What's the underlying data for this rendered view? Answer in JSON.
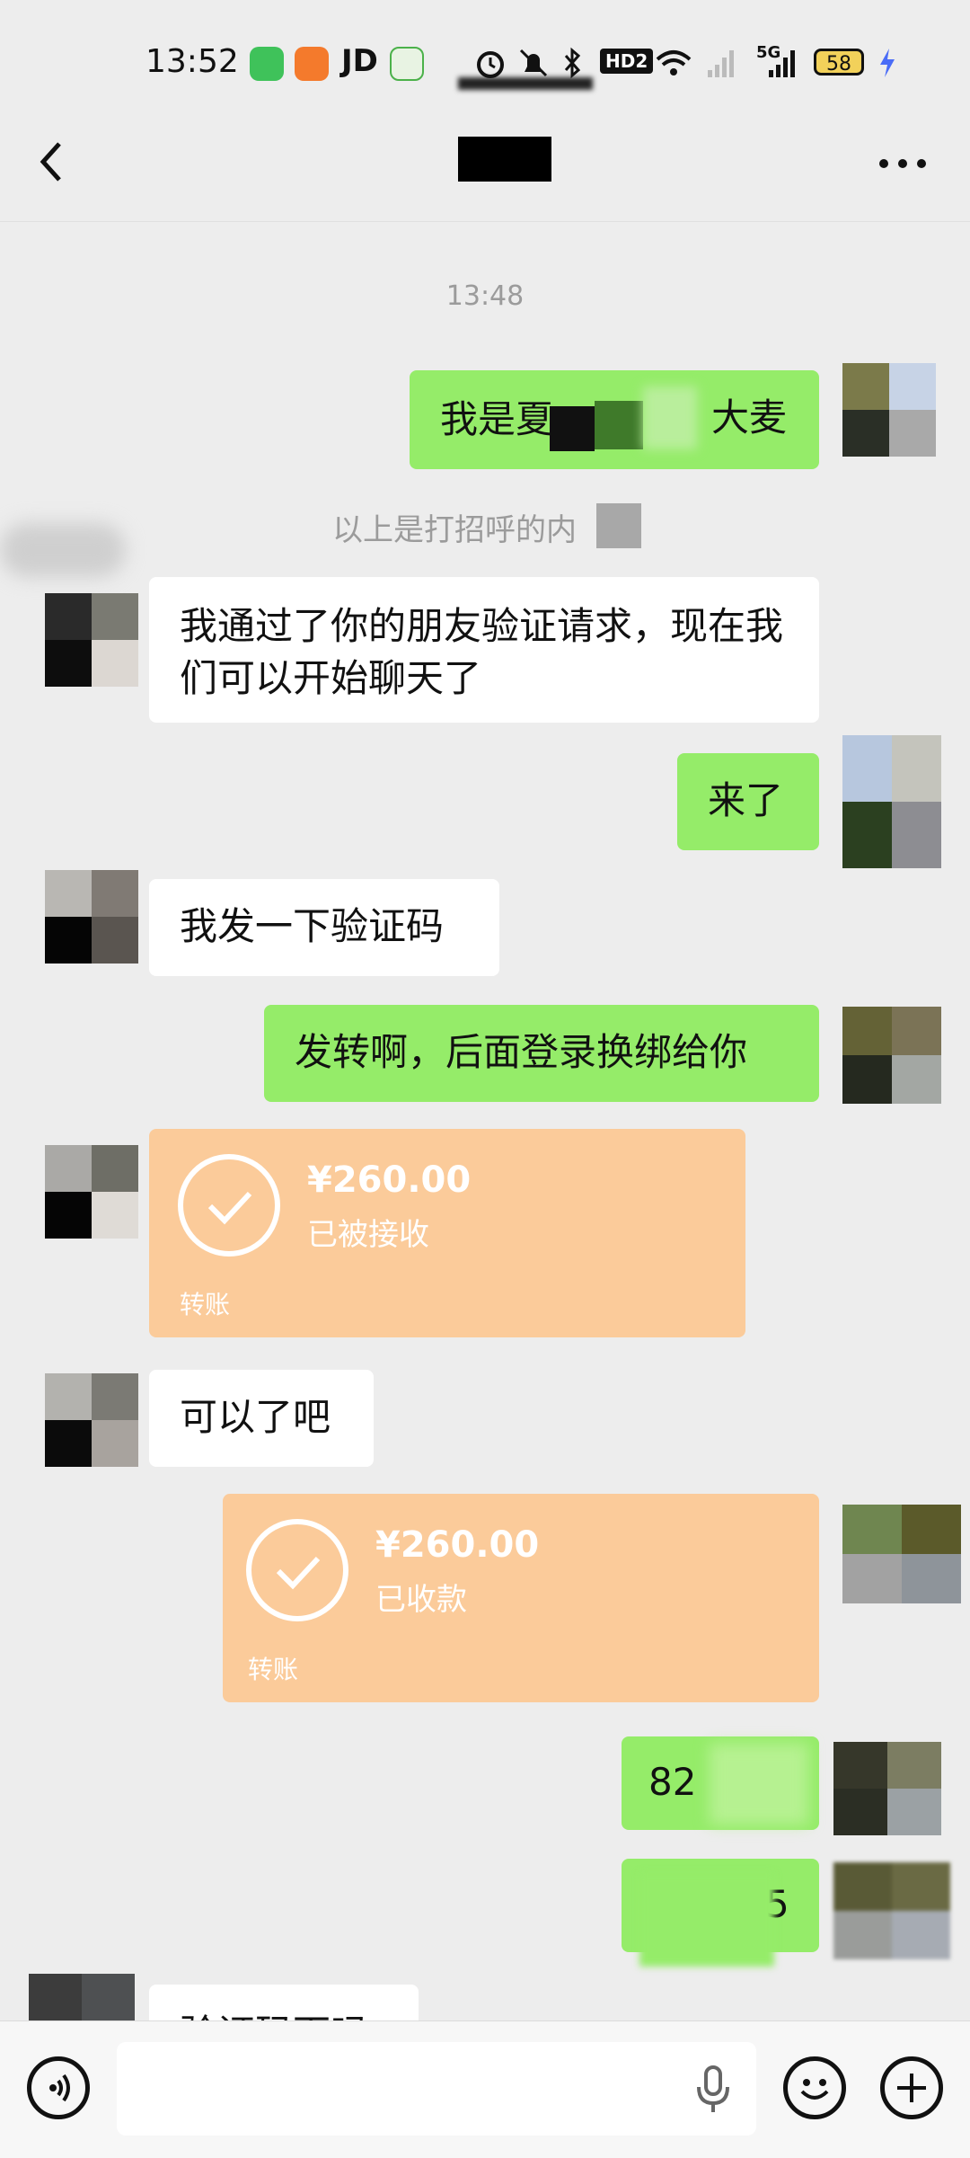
{
  "status_bar": {
    "time": "13:52",
    "jd_label": "JD",
    "hd_label": "HD2",
    "network_label": "5G",
    "battery": "58"
  },
  "header": {
    "more_label": "···"
  },
  "chat": {
    "timestamp": "13:48",
    "system_note": "以上是打招呼的内",
    "messages": {
      "m1": "我是夏",
      "m1_tail": "大麦",
      "m2": "我通过了你的朋友验证请求，现在我们可以开始聊天了",
      "m3": "来了",
      "m4": "我发一下验证码",
      "m5": "发转啊，后面登录换绑给你",
      "m7": "可以了吧",
      "m9": "82",
      "m10": "5",
      "m11": "验证码下吗"
    },
    "transfer_received": {
      "amount": "¥260.00",
      "status": "已被接收",
      "label": "转账"
    },
    "transfer_collected": {
      "amount": "¥260.00",
      "status": "已收款",
      "label": "转账"
    }
  },
  "colors": {
    "sent_bubble": "#95ec69",
    "received_bubble": "#ffffff",
    "transfer_card": "#fbcb9a",
    "background": "#ededed"
  },
  "icons": [
    "back-arrow-icon",
    "more-icon",
    "voice-icon",
    "microphone-icon",
    "emoji-icon",
    "plus-icon"
  ]
}
